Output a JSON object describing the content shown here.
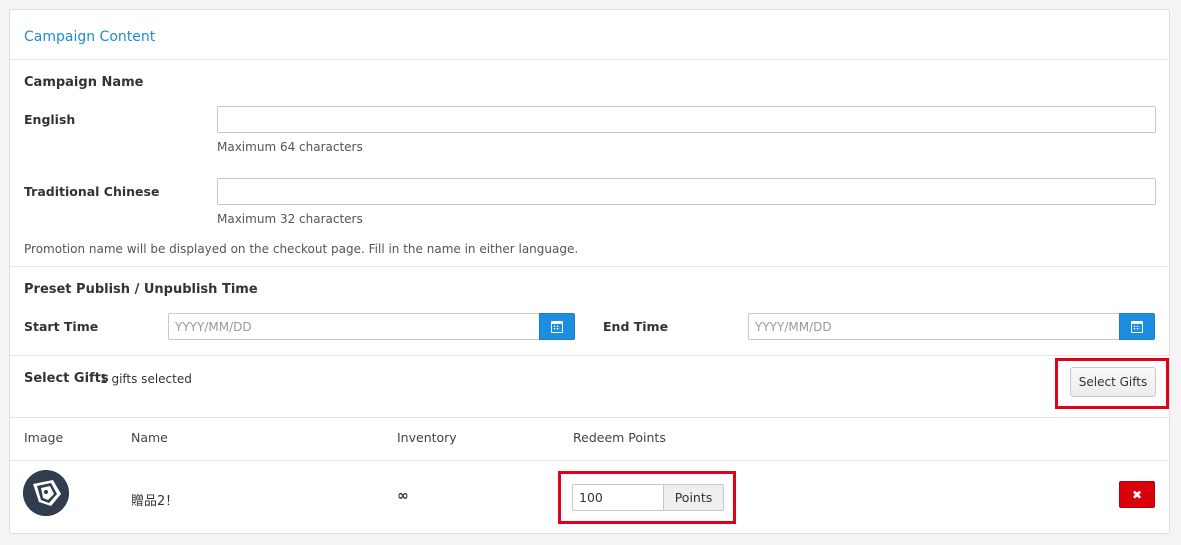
{
  "panel": {
    "title": "Campaign Content"
  },
  "campaign_name": {
    "title": "Campaign Name",
    "english_label": "English",
    "english_value": "",
    "english_hint": "Maximum 64 characters",
    "chinese_label": "Traditional Chinese",
    "chinese_value": "",
    "chinese_hint": "Maximum 32 characters",
    "note": "Promotion name will be displayed on the checkout page. Fill in the name in either language."
  },
  "publish_time": {
    "title": "Preset Publish / Unpublish Time",
    "start_label": "Start Time",
    "start_placeholder": "YYYY/MM/DD",
    "end_label": "End Time",
    "end_placeholder": "YYYY/MM/DD",
    "calendar_icon": "calendar-icon"
  },
  "gifts": {
    "title": "Select Gifts",
    "count_text": "1 gifts selected",
    "select_button": "Select Gifts",
    "table": {
      "headers": [
        "Image",
        "Name",
        "Inventory",
        "Redeem Points"
      ],
      "rows": [
        {
          "image_icon": "gift-avatar-icon",
          "name": "贈品2！",
          "inventory": "∞",
          "points": "100",
          "points_addon": "Points",
          "delete_icon": "close-icon"
        }
      ]
    }
  },
  "colors": {
    "accent": "#1a8fd3",
    "calendar_button": "#1d8ddf",
    "danger": "#d9000d",
    "highlight": "#e3001b"
  }
}
